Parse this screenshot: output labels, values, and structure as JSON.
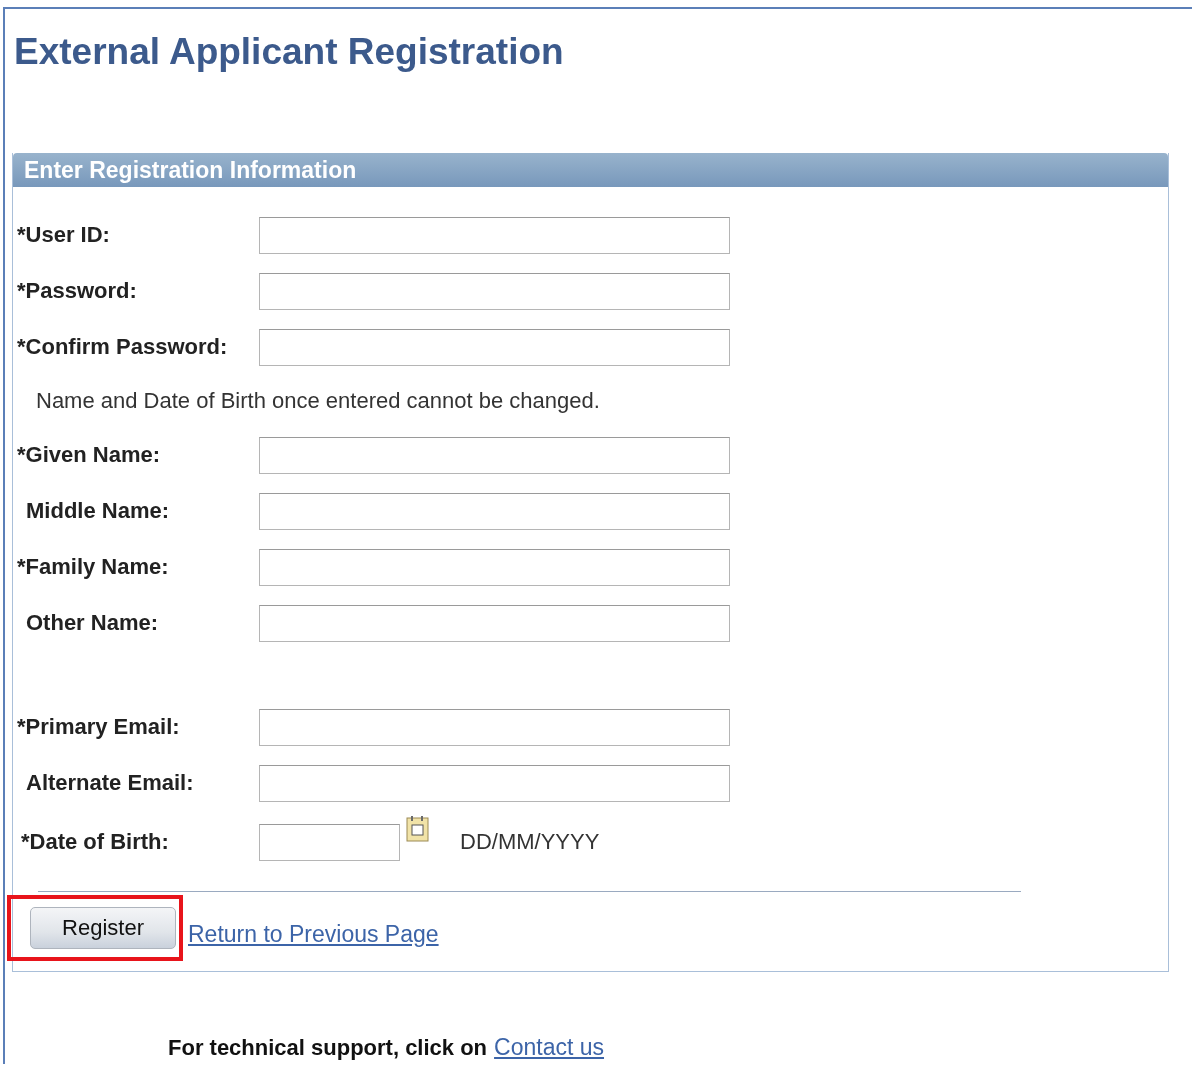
{
  "title": "External Applicant Registration",
  "panel": {
    "header": "Enter Registration Information",
    "field_groups": [
      [
        {
          "label": "*User ID:",
          "required": true,
          "kind": "text"
        },
        {
          "label": "*Password:",
          "required": true,
          "kind": "text"
        },
        {
          "label": "*Confirm Password:",
          "required": true,
          "kind": "text"
        },
        {
          "kind": "note",
          "text": "Name and Date of Birth once entered cannot be changed."
        },
        {
          "label": "*Given Name:",
          "required": true,
          "kind": "text"
        },
        {
          "label": "Middle Name:",
          "required": false,
          "kind": "text"
        },
        {
          "label": "*Family Name:",
          "required": true,
          "kind": "text"
        },
        {
          "label": "Other Name:",
          "required": false,
          "kind": "text"
        }
      ],
      [
        {
          "label": "*Primary Email:",
          "required": true,
          "kind": "text"
        },
        {
          "label": "Alternate Email:",
          "required": false,
          "kind": "text"
        },
        {
          "label": "*Date of Birth:",
          "required": true,
          "kind": "date",
          "format": "DD/MM/YYYY"
        }
      ]
    ],
    "register_button": {
      "label": "Register",
      "highlighted": true
    },
    "return_link": "Return to Previous Page"
  },
  "footer": {
    "text": "For technical support, click on",
    "link": "Contact us"
  }
}
